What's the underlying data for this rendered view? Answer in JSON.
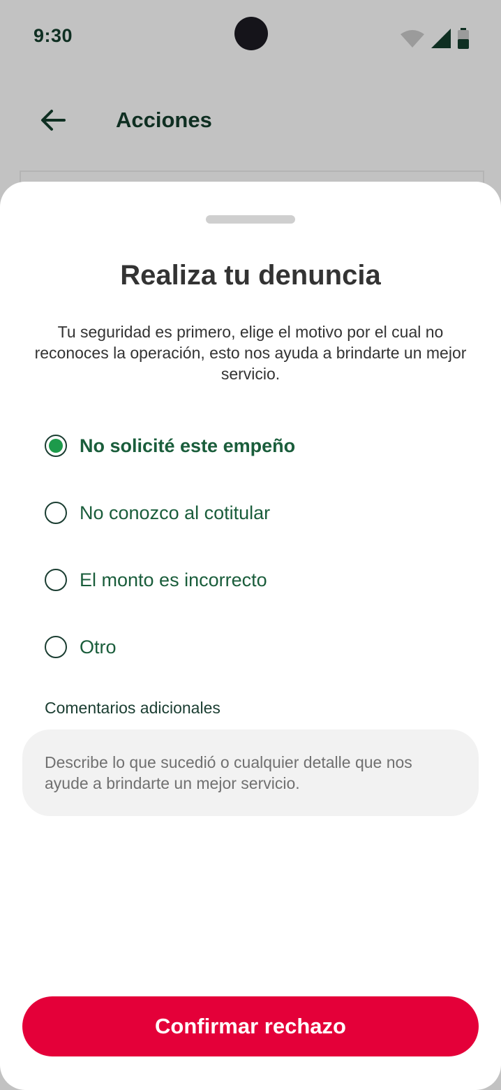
{
  "status_bar": {
    "time": "9:30",
    "icons": [
      "wifi-icon",
      "signal-icon",
      "battery-icon"
    ]
  },
  "app_bar": {
    "title": "Acciones",
    "back_icon": "arrow-left-icon"
  },
  "sheet": {
    "title": "Realiza tu denuncia",
    "description": "Tu seguridad es primero, elige el motivo por el cual no reconoces la operación, esto nos ayuda a brindarte un mejor servicio.",
    "options": [
      {
        "label": "No solicité este empeño",
        "selected": true
      },
      {
        "label": "No conozco al cotitular",
        "selected": false
      },
      {
        "label": "El monto es incorrecto",
        "selected": false
      },
      {
        "label": "Otro",
        "selected": false
      }
    ],
    "comments": {
      "label": "Comentarios adicionales",
      "placeholder": "Describe lo que sucedió o cualquier detalle que nos ayude a brindarte un mejor servicio."
    },
    "confirm_label": "Confirmar rechazo"
  },
  "colors": {
    "brand_red": "#e40039",
    "brand_green": "#1a5d3b",
    "radio_selected": "#1d9a4b",
    "dark_green": "#0f2f22"
  }
}
